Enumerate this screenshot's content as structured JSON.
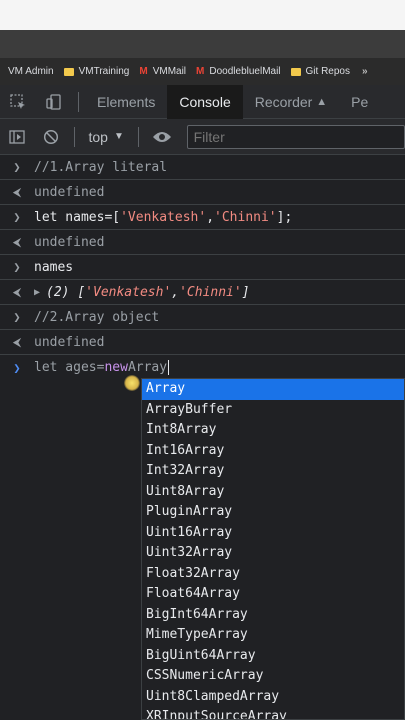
{
  "bookmarks": [
    {
      "label": "VM Admin",
      "icon": "none"
    },
    {
      "label": "VMTraining",
      "icon": "folder-icon"
    },
    {
      "label": "VMMail",
      "icon": "gmail-icon"
    },
    {
      "label": "DoodlebluelMail",
      "icon": "gmail-icon"
    },
    {
      "label": "Git Repos",
      "icon": "folder-icon"
    }
  ],
  "devtools": {
    "tabs": [
      "Elements",
      "Console",
      "Recorder",
      "Pe"
    ],
    "active_tab": "Console"
  },
  "toolbar": {
    "context": "top",
    "filter_placeholder": "Filter"
  },
  "console": {
    "l1": "//1.Array literal",
    "r1": "undefined",
    "l2_prefix": "let names=[",
    "l2_s1": "'Venkatesh'",
    "l2_comma": ",",
    "l2_s2": "'Chinni'",
    "l2_suffix": "];",
    "r2": "undefined",
    "l3": "names",
    "r3_prefix": "(2) [",
    "r3_s1": "'Venkatesh'",
    "r3_comma": ", ",
    "r3_s2": "'Chinni'",
    "r3_suffix": "]",
    "l4": "//2.Array object",
    "r4": "undefined",
    "input_prefix": "let ages=",
    "input_kw": "new",
    "input_rest": " Array"
  },
  "autocomplete": [
    "Array",
    "ArrayBuffer",
    "Int8Array",
    "Int16Array",
    "Int32Array",
    "Uint8Array",
    "PluginArray",
    "Uint16Array",
    "Uint32Array",
    "Float32Array",
    "Float64Array",
    "BigInt64Array",
    "MimeTypeArray",
    "BigUint64Array",
    "CSSNumericArray",
    "Uint8ClampedArray",
    "XRInputSourceArray"
  ],
  "colors": {
    "accent": "#1a73e8",
    "string": "#f28b82",
    "keyword": "#c792ea"
  }
}
